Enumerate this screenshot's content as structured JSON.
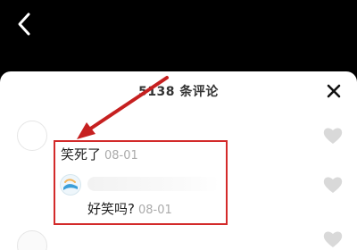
{
  "header": {
    "title": "5138 条评论"
  },
  "comment": {
    "text": "笑死了",
    "date": "08-01"
  },
  "reply": {
    "text": "好笑吗?",
    "date": "08-01"
  },
  "icons": {
    "back": "chevron-left-icon",
    "close": "close-icon",
    "like": "heart-icon"
  },
  "colors": {
    "annotation": "#d32a2a",
    "heart": "#d9d9d9"
  }
}
